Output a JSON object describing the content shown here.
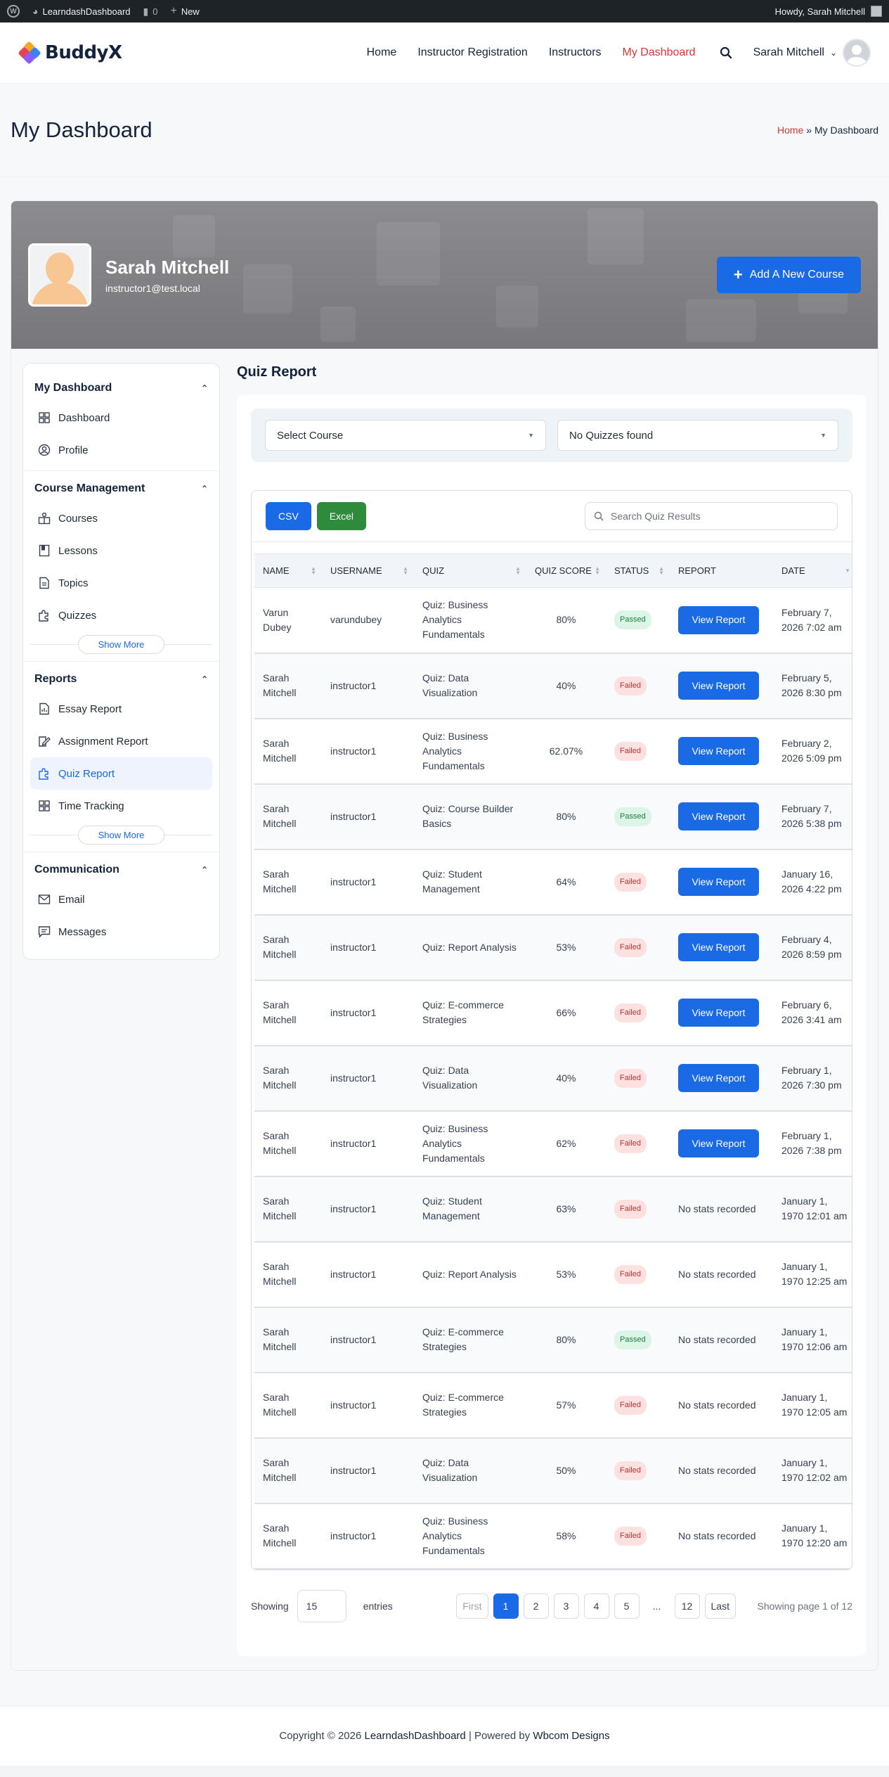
{
  "adminbar": {
    "site_name": "LearndashDashboard",
    "comments_count": "0",
    "new_label": "New",
    "howdy": "Howdy, Sarah Mitchell"
  },
  "header": {
    "logo_text": "BuddyX",
    "nav": [
      "Home",
      "Instructor Registration",
      "Instructors",
      "My Dashboard"
    ],
    "active_nav": "My Dashboard",
    "user_name": "Sarah Mitchell"
  },
  "titlebar": {
    "title": "My Dashboard",
    "breadcrumb_home": "Home",
    "breadcrumb_sep": " » ",
    "breadcrumb_current": "My Dashboard"
  },
  "profile": {
    "name": "Sarah Mitchell",
    "email": "instructor1@test.local",
    "add_course_label": "Add A New Course"
  },
  "sidebar": {
    "sections": [
      {
        "title": "My Dashboard",
        "items": [
          {
            "label": "Dashboard",
            "icon": "grid-icon"
          },
          {
            "label": "Profile",
            "icon": "user-circle-icon"
          }
        ]
      },
      {
        "title": "Course Management",
        "items": [
          {
            "label": "Courses",
            "icon": "courses-icon"
          },
          {
            "label": "Lessons",
            "icon": "book-icon"
          },
          {
            "label": "Topics",
            "icon": "document-icon"
          },
          {
            "label": "Quizzes",
            "icon": "puzzle-icon"
          }
        ],
        "show_more": "Show More"
      },
      {
        "title": "Reports",
        "items": [
          {
            "label": "Essay Report",
            "icon": "essay-report-icon"
          },
          {
            "label": "Assignment Report",
            "icon": "assignment-icon"
          },
          {
            "label": "Quiz Report",
            "icon": "puzzle-icon",
            "active": true
          },
          {
            "label": "Time Tracking",
            "icon": "grid-icon"
          }
        ],
        "show_more": "Show More"
      },
      {
        "title": "Communication",
        "items": [
          {
            "label": "Email",
            "icon": "mail-icon"
          },
          {
            "label": "Messages",
            "icon": "message-icon"
          }
        ]
      }
    ]
  },
  "report": {
    "title": "Quiz Report",
    "course_select": "Select Course",
    "quiz_select": "No Quizzes found",
    "csv_label": "CSV",
    "excel_label": "Excel",
    "search_placeholder": "Search Quiz Results",
    "columns": [
      "NAME",
      "USERNAME",
      "QUIZ",
      "QUIZ SCORE",
      "STATUS",
      "REPORT",
      "DATE"
    ],
    "view_report_label": "View Report",
    "no_stats_label": "No stats recorded",
    "rows": [
      {
        "name": "Varun Dubey",
        "username": "varundubey",
        "quiz": "Quiz: Business Analytics Fundamentals",
        "score": "80%",
        "status": "Passed",
        "report": "view",
        "date": "February 7, 2026 7:02 am"
      },
      {
        "name": "Sarah Mitchell",
        "username": "instructor1",
        "quiz": "Quiz: Data Visualization",
        "score": "40%",
        "status": "Failed",
        "report": "view",
        "date": "February 5, 2026 8:30 pm"
      },
      {
        "name": "Sarah Mitchell",
        "username": "instructor1",
        "quiz": "Quiz: Business Analytics Fundamentals",
        "score": "62.07%",
        "status": "Failed",
        "report": "view",
        "date": "February 2, 2026 5:09 pm"
      },
      {
        "name": "Sarah Mitchell",
        "username": "instructor1",
        "quiz": "Quiz: Course Builder Basics",
        "score": "80%",
        "status": "Passed",
        "report": "view",
        "date": "February 7, 2026 5:38 pm"
      },
      {
        "name": "Sarah Mitchell",
        "username": "instructor1",
        "quiz": "Quiz: Student Management",
        "score": "64%",
        "status": "Failed",
        "report": "view",
        "date": "January 16, 2026 4:22 pm"
      },
      {
        "name": "Sarah Mitchell",
        "username": "instructor1",
        "quiz": "Quiz: Report Analysis",
        "score": "53%",
        "status": "Failed",
        "report": "view",
        "date": "February 4, 2026 8:59 pm"
      },
      {
        "name": "Sarah Mitchell",
        "username": "instructor1",
        "quiz": "Quiz: E-commerce Strategies",
        "score": "66%",
        "status": "Failed",
        "report": "view",
        "date": "February 6, 2026 3:41 am"
      },
      {
        "name": "Sarah Mitchell",
        "username": "instructor1",
        "quiz": "Quiz: Data Visualization",
        "score": "40%",
        "status": "Failed",
        "report": "view",
        "date": "February 1, 2026 7:30 pm"
      },
      {
        "name": "Sarah Mitchell",
        "username": "instructor1",
        "quiz": "Quiz: Business Analytics Fundamentals",
        "score": "62%",
        "status": "Failed",
        "report": "view",
        "date": "February 1, 2026 7:38 pm"
      },
      {
        "name": "Sarah Mitchell",
        "username": "instructor1",
        "quiz": "Quiz: Student Management",
        "score": "63%",
        "status": "Failed",
        "report": "none",
        "date": "January 1, 1970 12:01 am"
      },
      {
        "name": "Sarah Mitchell",
        "username": "instructor1",
        "quiz": "Quiz: Report Analysis",
        "score": "53%",
        "status": "Failed",
        "report": "none",
        "date": "January 1, 1970 12:25 am"
      },
      {
        "name": "Sarah Mitchell",
        "username": "instructor1",
        "quiz": "Quiz: E-commerce Strategies",
        "score": "80%",
        "status": "Passed",
        "report": "none",
        "date": "January 1, 1970 12:06 am"
      },
      {
        "name": "Sarah Mitchell",
        "username": "instructor1",
        "quiz": "Quiz: E-commerce Strategies",
        "score": "57%",
        "status": "Failed",
        "report": "none",
        "date": "January 1, 1970 12:05 am"
      },
      {
        "name": "Sarah Mitchell",
        "username": "instructor1",
        "quiz": "Quiz: Data Visualization",
        "score": "50%",
        "status": "Failed",
        "report": "none",
        "date": "January 1, 1970 12:02 am"
      },
      {
        "name": "Sarah Mitchell",
        "username": "instructor1",
        "quiz": "Quiz: Business Analytics Fundamentals",
        "score": "58%",
        "status": "Failed",
        "report": "none",
        "date": "January 1, 1970 12:20 am"
      }
    ],
    "pagination": {
      "showing_label": "Showing",
      "entries_value": "15",
      "entries_label": "entries",
      "first_label": "First",
      "pages": [
        "1",
        "2",
        "3",
        "4",
        "5"
      ],
      "ellipsis": "...",
      "last_page": "12",
      "last_label": "Last",
      "current_page": "1",
      "page_info": "Showing page 1 of 12"
    }
  },
  "footer": {
    "copyright": "Copyright © 2026 ",
    "site_link": "LearndashDashboard",
    "powered_by": " | Powered by ",
    "designer_link": "Wbcom Designs"
  },
  "colors": {
    "primary": "#1a6ae6",
    "active_nav": "#d63638",
    "excel": "#2e8b3b",
    "passed_bg": "#dcf5e6",
    "failed_bg": "#fde0e0"
  }
}
